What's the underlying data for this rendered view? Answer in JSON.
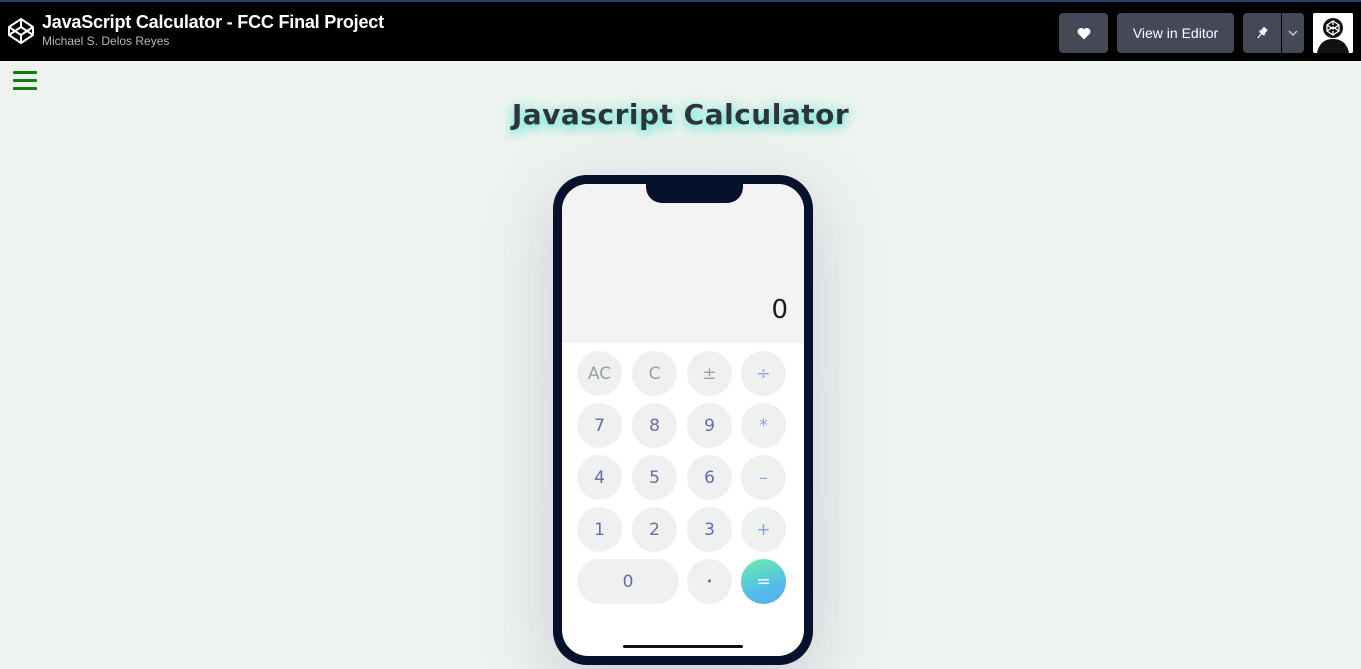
{
  "header": {
    "pen_title": "JavaScript Calculator - FCC Final Project",
    "author": "Michael S. Delos Reyes",
    "view_in_editor_label": "View in Editor",
    "icons": {
      "logo": "codepen-logo-icon",
      "heart": "heart-icon",
      "pin": "pin-icon",
      "caret": "chevron-down-icon",
      "avatar": "user-avatar"
    }
  },
  "page": {
    "title": "Javascript Calculator",
    "menu_icon": "hamburger-menu-icon"
  },
  "calculator": {
    "display": "0",
    "keys": {
      "ac": "AC",
      "c": "C",
      "plusminus": "±",
      "divide": "÷",
      "seven": "7",
      "eight": "8",
      "nine": "9",
      "multiply": "*",
      "four": "4",
      "five": "5",
      "six": "6",
      "subtract": "–",
      "one": "1",
      "two": "2",
      "three": "3",
      "add": "+",
      "zero": "0",
      "decimal": "•",
      "equals": "="
    }
  },
  "colors": {
    "topbar_bg": "#010101",
    "button_bg": "#444857",
    "page_bg": "#eef3ef",
    "menu_icon": "#117a11",
    "phone_frame": "#06122b",
    "key_bg": "#eef1ef",
    "digit_text": "#6b6aa8",
    "operator_text": "#7fa4e2",
    "equals_gradient_start": "#6ff0a8",
    "equals_gradient_end": "#5aa8f0"
  }
}
